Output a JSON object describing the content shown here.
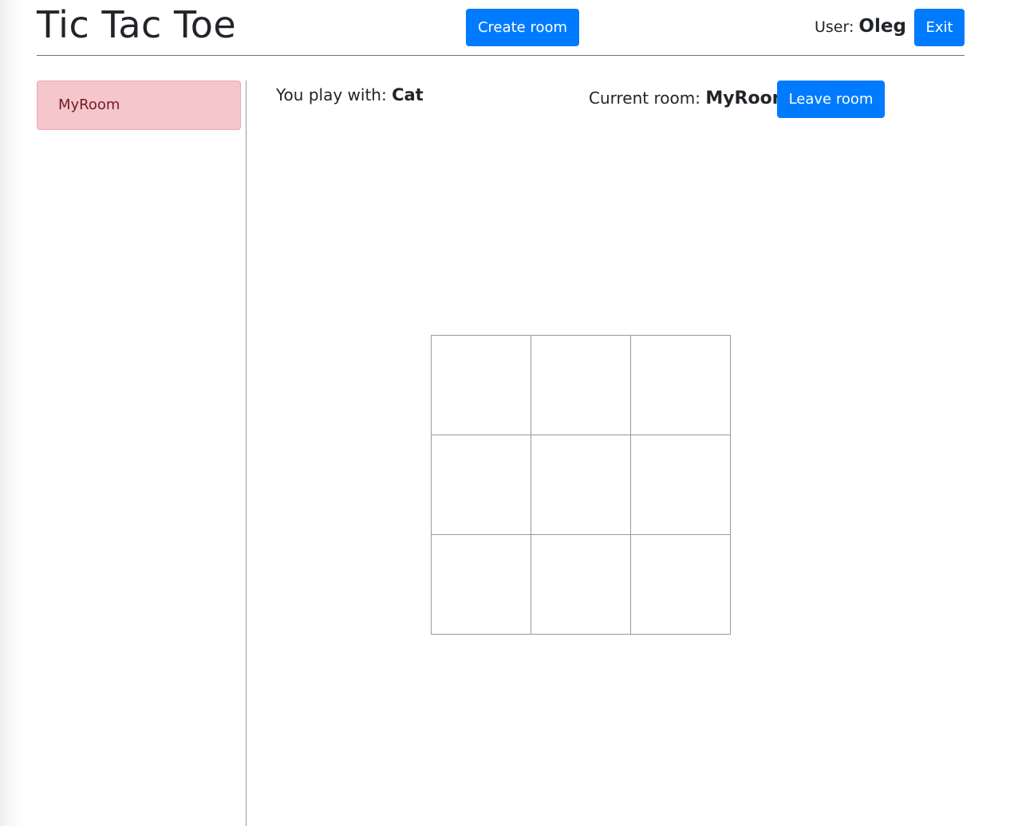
{
  "header": {
    "title": "Tic Tac Toe",
    "create_room_label": "Create room",
    "user_label": "User:",
    "user_name": "Oleg",
    "exit_label": "Exit"
  },
  "sidebar": {
    "rooms": [
      {
        "name": "MyRoom"
      }
    ]
  },
  "game": {
    "play_with_label": "You play with:",
    "opponent": "Cat",
    "current_room_label": "Current room:",
    "current_room": "MyRoom",
    "leave_room_label": "Leave room",
    "board": [
      "",
      "",
      "",
      "",
      "",
      "",
      "",
      "",
      ""
    ]
  },
  "colors": {
    "primary": "#007bff",
    "room_item_bg": "#f5c6cb",
    "room_item_text": "#721c24",
    "grid_line": "#999999"
  }
}
